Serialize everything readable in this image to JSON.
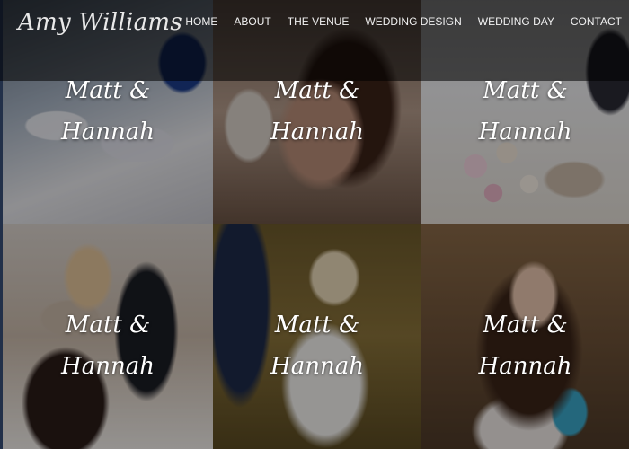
{
  "brand": {
    "name": "Amy Williams"
  },
  "nav": {
    "items": [
      {
        "label": "HOME"
      },
      {
        "label": "ABOUT"
      },
      {
        "label": "THE VENUE"
      },
      {
        "label": "WEDDING DESIGN"
      },
      {
        "label": "WEDDING DAY"
      },
      {
        "label": "CONTACT"
      }
    ]
  },
  "gallery": {
    "tiles": [
      {
        "line1": "Matt &",
        "line2": "Hannah"
      },
      {
        "line1": "Matt &",
        "line2": "Hannah"
      },
      {
        "line1": "Matt &",
        "line2": "Hannah"
      },
      {
        "line1": "Matt &",
        "line2": "Hannah"
      },
      {
        "line1": "Matt &",
        "line2": "Hannah"
      },
      {
        "line1": "Matt &",
        "line2": "Hannah"
      }
    ]
  }
}
